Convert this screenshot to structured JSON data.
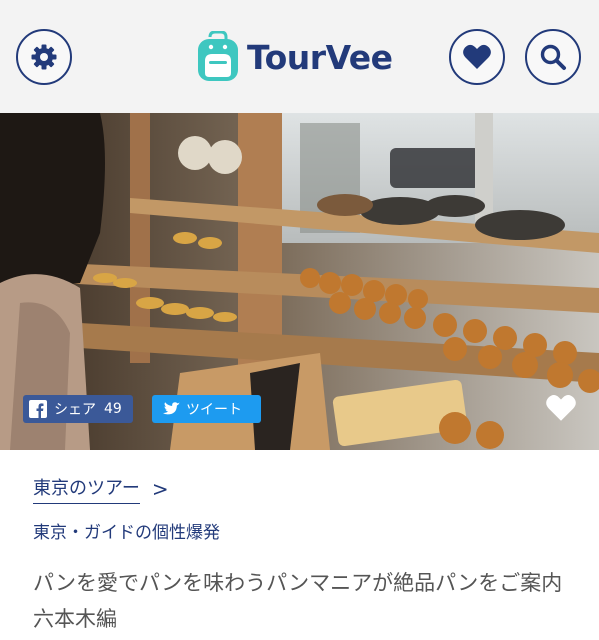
{
  "app": {
    "brand": "TourVee",
    "accent": "#223a7a",
    "logo_color": "#3ec7c0"
  },
  "header": {
    "settings_icon": "gear-icon",
    "favorite_icon": "heart-icon",
    "search_icon": "search-icon"
  },
  "hero": {
    "image_subject": "bakery-display-photo",
    "facebook_label": "シェア",
    "facebook_count": "49",
    "twitter_label": "ツイート",
    "favorite_icon": "heart-icon",
    "colors": {
      "facebook": "#3b5998",
      "twitter": "#1d9bf0"
    }
  },
  "article": {
    "breadcrumb": "東京のツアー",
    "breadcrumb_arrow": ">",
    "subtitle": "東京・ガイドの個性爆発",
    "title": "パンを愛でパンを味わうパンマニアが絶品パンをご案内　六本木編"
  }
}
